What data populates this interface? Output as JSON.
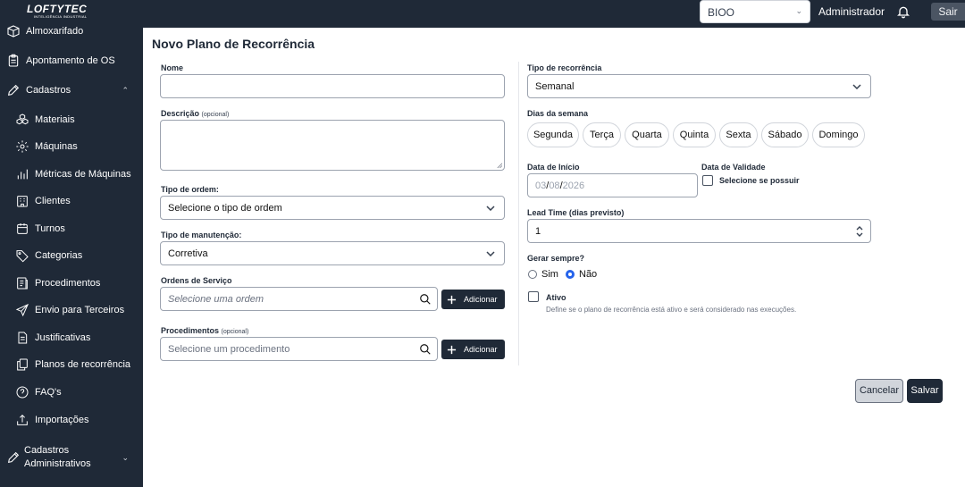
{
  "header": {
    "logo_text": "LOFTYTEC",
    "logo_subtext": "INTELIGÊNCIA INDUSTRIAL",
    "company_select": "BIOO",
    "user": "Administrador",
    "logout": "Sair"
  },
  "sidebar": {
    "items": [
      {
        "label": "Almoxarifado",
        "icon": "box-icon"
      },
      {
        "label": "Apontamento de OS",
        "icon": "clipboard-icon"
      },
      {
        "label": "Cadastros",
        "icon": "pencil-icon"
      },
      {
        "label": "Materiais",
        "icon": "cubes-icon"
      },
      {
        "label": "Máquinas",
        "icon": "gear-icon"
      },
      {
        "label": "Métricas de Máquinas",
        "icon": "bar-chart-icon"
      },
      {
        "label": "Clientes",
        "icon": "building-icon"
      },
      {
        "label": "Turnos",
        "icon": "calendar-icon"
      },
      {
        "label": "Categorias",
        "icon": "tag-icon"
      },
      {
        "label": "Procedimentos",
        "icon": "list-icon"
      },
      {
        "label": "Envio para Terceiros",
        "icon": "send-icon"
      },
      {
        "label": "Justificativas",
        "icon": "document-icon"
      },
      {
        "label": "Planos de recorrência",
        "icon": "copy-icon"
      },
      {
        "label": "FAQ's",
        "icon": "question-icon"
      },
      {
        "label": "Importações",
        "icon": "upload-icon"
      }
    ],
    "admin_line1": "Cadastros",
    "admin_line2": "Administrativos"
  },
  "form": {
    "title": "Novo Plano de Recorrência",
    "nome_label": "Nome",
    "nome_value": "",
    "descricao_label": "Descrição",
    "optional": "(opcional)",
    "tipo_ordem_label": "Tipo de ordem:",
    "tipo_ordem_value": "Selecione o tipo de ordem",
    "tipo_manutencao_label": "Tipo de manutenção:",
    "tipo_manutencao_value": "Corretiva",
    "ordens_label": "Ordens de Serviço",
    "ordens_placeholder": "Selecione uma ordem",
    "procedimentos_label": "Procedimentos",
    "procedimentos_placeholder": "Selecione um procedimento",
    "add_label": "Adicionar",
    "tipo_recorrencia_label": "Tipo de recorrência",
    "tipo_recorrencia_value": "Semanal",
    "dias_label": "Dias da semana",
    "dias": [
      "Segunda",
      "Terça",
      "Quarta",
      "Quinta",
      "Sexta",
      "Sábado",
      "Domingo"
    ],
    "data_inicio_label": "Data de Início",
    "data_inicio_day": "03",
    "data_inicio_month": "08",
    "data_inicio_year": "2026",
    "data_validade_label": "Data de Validade",
    "data_validade_check": "Selecione se possuir",
    "lead_time_label": "Lead Time (dias previsto)",
    "lead_time_value": "1",
    "gerar_label": "Gerar sempre?",
    "opt_sim": "Sim",
    "opt_nao": "Não",
    "gerar_selected": "Não",
    "ativo_label": "Ativo",
    "ativo_hint": "Define se o plano de recorrência está ativo e será considerado nas execuções.",
    "cancel": "Cancelar",
    "save": "Salvar"
  },
  "colors": {
    "sidebar_bg": "#1f2937",
    "primary": "#1f2937",
    "radio_accent": "#2563eb"
  }
}
